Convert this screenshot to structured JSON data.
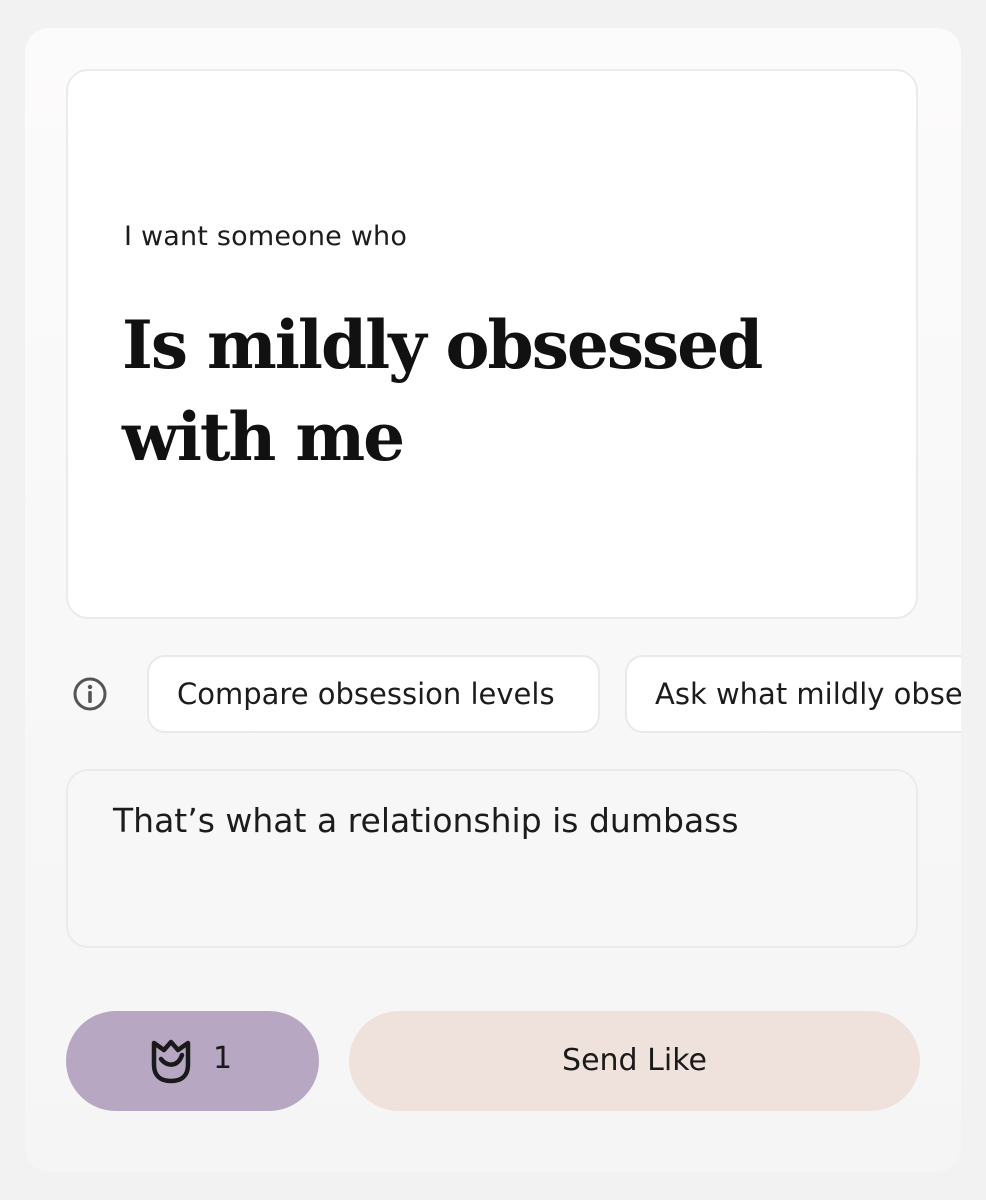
{
  "prompt": {
    "label": "I want someone who",
    "answer": "Is mildly obsessed with me"
  },
  "info_icon": "info-circle-icon",
  "suggestions": [
    {
      "label": "Compare obsession levels"
    },
    {
      "label": "Ask what mildly obse"
    }
  ],
  "comment": {
    "value": "That’s what a relationship is dumbass"
  },
  "rose_button": {
    "icon": "rose-icon",
    "count": "1",
    "color": "#b8a7c3"
  },
  "send_button": {
    "label": "Send Like",
    "color": "#efe2dd"
  }
}
